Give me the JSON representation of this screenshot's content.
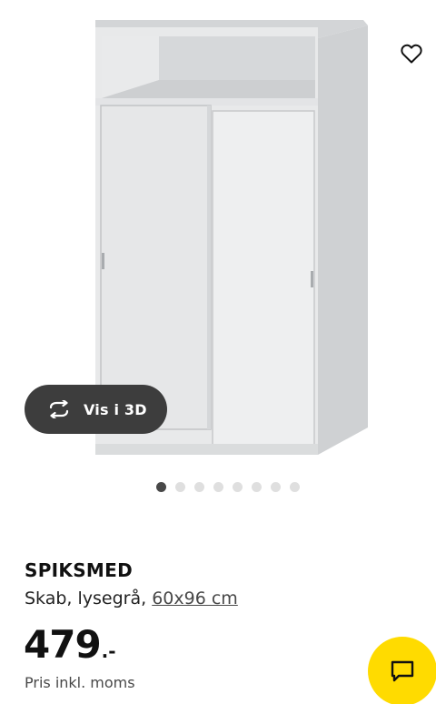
{
  "gallery": {
    "image_alt": "SPIKSMED cabinet with sliding doors",
    "view3d_label": "Vis i 3D",
    "dot_count": 8,
    "active_dot": 0,
    "icons": {
      "favorite": "heart-outline-icon",
      "view3d": "rotate-3d-icon"
    }
  },
  "product": {
    "name": "SPIKSMED",
    "description_prefix": "Skab, lysegrå, ",
    "size_link": "60x96 cm",
    "price_integer": "479",
    "price_suffix": ".-",
    "price_note": "Pris inkl. moms"
  },
  "chat": {
    "icon": "chat-bubble-icon"
  },
  "colors": {
    "accent": "#ffdb00",
    "pill": "#3d3d3d",
    "dot_active": "#484848",
    "dot_inactive": "#dfdfdf"
  }
}
